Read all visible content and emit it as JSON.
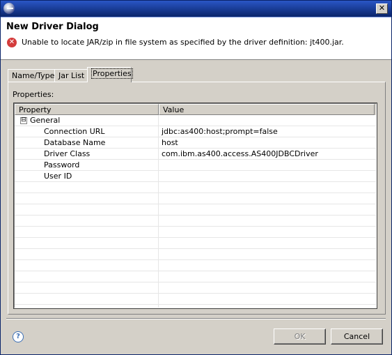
{
  "window": {
    "close_glyph": "✕"
  },
  "header": {
    "title": "New Driver Dialog",
    "error_message": "Unable to locate JAR/zip in file system as specified by the driver definition: jt400.jar."
  },
  "tabs": [
    {
      "label": "Name/Type"
    },
    {
      "label": "Jar List"
    },
    {
      "label": "Properties"
    }
  ],
  "properties": {
    "label": "Properties:",
    "columns": [
      "Property",
      "Value"
    ],
    "group": {
      "expander": "⊟",
      "label": "General"
    },
    "rows": [
      {
        "property": "Connection URL",
        "value": "jdbc:as400:host;prompt=false"
      },
      {
        "property": "Database Name",
        "value": "host"
      },
      {
        "property": "Driver Class",
        "value": "com.ibm.as400.access.AS400JDBCDriver"
      },
      {
        "property": "Password",
        "value": ""
      },
      {
        "property": "User ID",
        "value": ""
      }
    ]
  },
  "footer": {
    "help_glyph": "?",
    "ok_label": "OK",
    "cancel_label": "Cancel"
  },
  "icons": {
    "title": "eclipse-icon",
    "error": "error-icon",
    "help": "help-icon"
  }
}
